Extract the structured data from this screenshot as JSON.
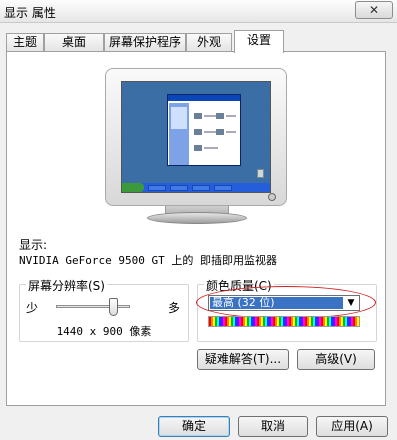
{
  "window": {
    "title": "显示 属性",
    "close_label": "✕"
  },
  "tabs": [
    {
      "label": "主题",
      "active": false
    },
    {
      "label": "桌面",
      "active": false
    },
    {
      "label": "屏幕保护程序",
      "active": false
    },
    {
      "label": "外观",
      "active": false
    },
    {
      "label": "设置",
      "active": true
    }
  ],
  "settings": {
    "display_label": "显示:",
    "device_name": "NVIDIA GeForce 9500 GT 上的 即插即用监视器",
    "resolution": {
      "group_title": "屏幕分辨率(S)",
      "less_label": "少",
      "more_label": "多",
      "value_text": "1440 x 900 像素",
      "slider_level": 0.78
    },
    "color_quality": {
      "group_title": "颜色质量(C)",
      "selected": "最高 (32 位)"
    },
    "troubleshoot_button": "疑难解答(T)...",
    "advanced_button": "高级(V)"
  },
  "footer": {
    "ok": "确定",
    "cancel": "取消",
    "apply": "应用(A)"
  },
  "colors": {
    "accent": "#3b73c4",
    "highlight_ring": "#d02020",
    "desktop": "#3a6ea5"
  }
}
